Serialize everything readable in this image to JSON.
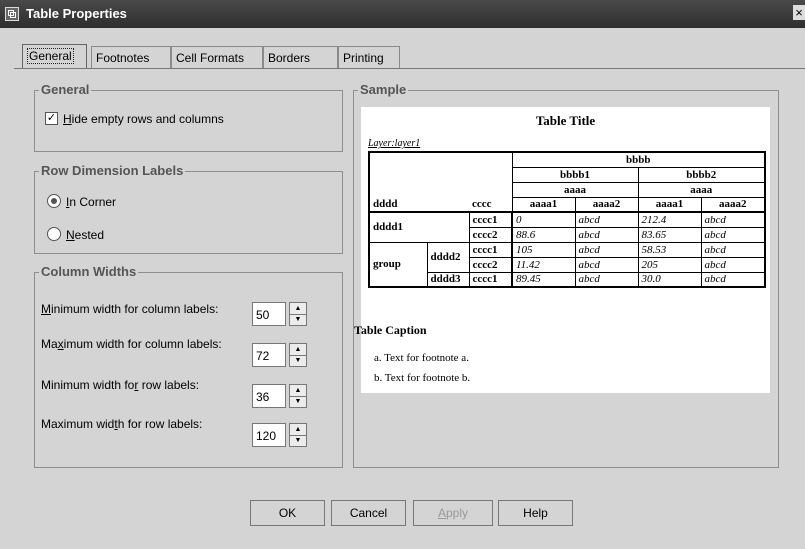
{
  "window": {
    "title": "Table Properties",
    "close": "×"
  },
  "tabs": [
    "General",
    "Footnotes",
    "Cell Formats",
    "Borders",
    "Printing"
  ],
  "general": {
    "legend": "General",
    "hide_empty_prefix": "H",
    "hide_empty_label": "ide empty rows and columns",
    "hide_empty_checked": true,
    "check_mark": "✓"
  },
  "row_labels": {
    "legend": "Row Dimension Labels",
    "in_corner_prefix": "I",
    "in_corner_label": "n Corner",
    "nested_prefix": "N",
    "nested_label": "ested",
    "selected": "In Corner"
  },
  "column_widths": {
    "legend": "Column Widths",
    "min_col_pre": "",
    "min_col_u": "M",
    "min_col_post": "inimum width for column labels:",
    "min_col_value": "50",
    "max_col_pre": "Ma",
    "max_col_u": "x",
    "max_col_post": "imum width for column labels:",
    "max_col_value": "72",
    "min_row_pre": "Minimum width fo",
    "min_row_u": "r",
    "min_row_post": " row labels:",
    "min_row_value": "36",
    "max_row_pre": "Maximum wid",
    "max_row_u": "t",
    "max_row_post": "h for row labels:",
    "max_row_value": "120",
    "up": "▲",
    "down": "▼"
  },
  "sample": {
    "legend": "Sample",
    "table_title": "Table Title",
    "layer": "Layer:layer1",
    "col_dim": "bbbb",
    "col_sub1": "bbbb1",
    "col_sub2": "bbbb2",
    "aaaa": "aaaa",
    "row_dim": "dddd",
    "row_sub": "cccc",
    "col_leaf": [
      "aaaa1",
      "aaaa2",
      "aaaa1",
      "aaaa2"
    ],
    "rows": [
      {
        "g1": "dddd1",
        "g2": "",
        "c": "cccc1",
        "v": [
          "0",
          "abcd",
          "212.4",
          "abcd"
        ]
      },
      {
        "g1": "",
        "g2": "",
        "c": "cccc2",
        "v": [
          "88.6",
          "abcd",
          "83.65",
          "abcd"
        ]
      },
      {
        "g1": "group",
        "g2": "dddd2",
        "c": "cccc1",
        "v": [
          "105",
          "abcd",
          "58.53",
          "abcd"
        ]
      },
      {
        "g1": "",
        "g2": "",
        "c": "cccc2",
        "v": [
          "11.42",
          "abcd",
          "205",
          "abcd"
        ]
      },
      {
        "g1": "",
        "g2": "dddd3",
        "c": "cccc1",
        "v": [
          "89.45",
          "abcd",
          "30.0",
          "abcd"
        ]
      }
    ],
    "caption": "Table Caption",
    "footnotes": [
      "a. Text for footnote a.",
      "b. Text for footnote b."
    ]
  },
  "buttons": {
    "ok": "OK",
    "cancel": "Cancel",
    "apply_u": "A",
    "apply_rest": "pply",
    "help": "Help"
  }
}
